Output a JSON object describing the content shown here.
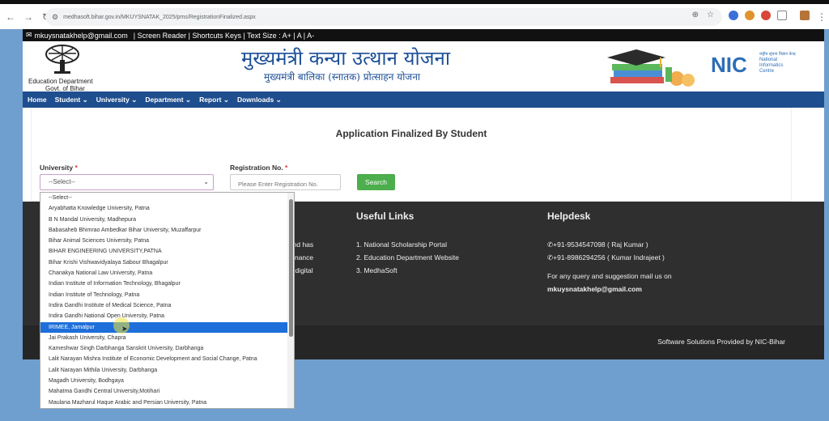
{
  "browser": {
    "url": "medhasoft.bihar.gov.in/MKUYSNATAK_2025/pms/RegistrationFinalized.aspx"
  },
  "topbar": {
    "email": "mkuysnatakhelp@gmail.com",
    "links": "| Screen Reader | Shortcuts Keys | Text Size : A+ | A | A-"
  },
  "header": {
    "dept_line1": "Education Department",
    "dept_line2": "Govt. of Bihar",
    "title": "मुख्यमंत्री कन्या उत्थान योजना",
    "subtitle": "मुख्यमंत्री बालिका (स्नातक) प्रोत्साहन योजना",
    "nic_small": "राष्ट्रीय सूचना विज्ञान केन्द्र",
    "nic_en1": "National",
    "nic_en2": "Informatics",
    "nic_en3": "Centre"
  },
  "nav": {
    "items": [
      "Home",
      "Student ⌄",
      "University ⌄",
      "Department ⌄",
      "Report ⌄",
      "Downloads ⌄"
    ]
  },
  "form": {
    "title": "Application Finalized By Student",
    "university_label": "University",
    "required_mark": "*",
    "university_value": "--Select--",
    "registration_label": "Registration No.",
    "registration_placeholder": "Please Enter Registration No.",
    "search_label": "Search"
  },
  "footer": {
    "partial": [
      "976, and has",
      "-Governance",
      "oter of digital"
    ],
    "useful_title": "Useful Links",
    "useful_links": [
      "1. National Scholarship Portal",
      "2. Education Department Website",
      "3. MedhaSoft"
    ],
    "helpdesk_title": "Helpdesk",
    "phone1": "+91-9534547098 ( Raj Kumar )",
    "phone2": "+91-8986294256 ( Kumar Indrajeet )",
    "query_text": "For any query and suggestion mail us on",
    "help_email": "mkuysnatakhelp@gmail.com",
    "credit": "Software Solutions Provided by NIC-Bihar"
  },
  "dropdown": {
    "highlighted_index": 12,
    "options": [
      "--Select--",
      "Aryabhatta Knowledge University, Patna",
      "B N Mandal University, Madhepura",
      "Babasaheb Bhimrao Ambedkar Bihar University, Muzaffarpur",
      "Bihar Animal Sciences University, Patna",
      "BIHAR ENGINEERING UNIVERSITY,PATNA",
      "Bihar Krishi Vishwavidyalaya Sabour Bhagalpur",
      "Chanakya National Law University, Patna",
      "Indian Institute of Information Technology, Bhagalpur",
      "Indian Institute of Technology, Patna",
      "Indira Gandhi Institute of Medical Science, Patna",
      "Indira Gandhi National Open University, Patna",
      "IRIMEE, Jamalpur",
      "Jai Prakash University, Chapra",
      "Kameshwar Singh Darbhanga Sanskrit University, Darbhanga",
      "Lalit Narayan Mishra Institute of Economic Development and Social Change, Patna",
      "Lalit Narayan Mithila University, Darbhanga",
      "Magadh University, Bodhgaya",
      "Mahatma Gandhi Central University,Motihari",
      "Maulana Mazharul Haque Arabic and Persian University, Patna"
    ]
  }
}
